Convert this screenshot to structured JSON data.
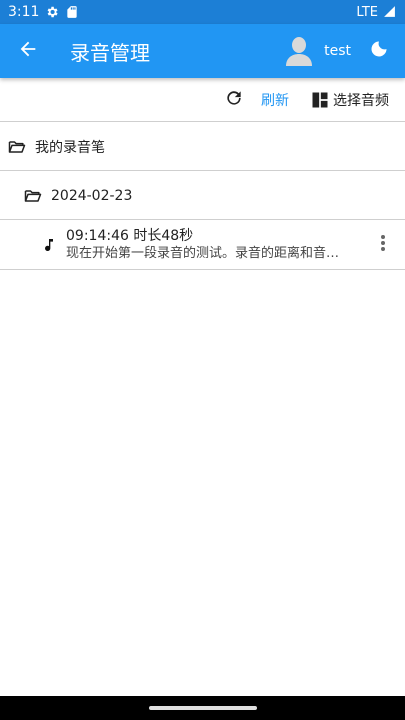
{
  "status_bar": {
    "time": "3:11",
    "network": "LTE"
  },
  "app_bar": {
    "title": "录音管理",
    "user_name": "test"
  },
  "toolbar": {
    "refresh_label": "刷新",
    "select_audio_label": "选择音频"
  },
  "tree": {
    "root_folder": "我的录音笔",
    "date_folder": "2024-02-23",
    "files": [
      {
        "title": "09:14:46 时长48秒",
        "subtitle": "现在开始第一段录音的测试。录音的距离和音…"
      }
    ]
  },
  "colors": {
    "status_bar": "#1c7fd6",
    "app_bar": "#2196f3",
    "accent": "#2196f3",
    "divider": "#cfcfcf"
  },
  "icons": {
    "status": [
      "settings-icon",
      "sd-card-icon",
      "signal-icon"
    ],
    "back": "arrow-left-icon",
    "avatar": "user-avatar-icon",
    "theme": "moon-icon",
    "refresh": "refresh-icon",
    "select_audio": "dashboard-icon",
    "folder": "folder-open-icon",
    "file": "music-note-icon",
    "more": "more-vertical-icon"
  }
}
